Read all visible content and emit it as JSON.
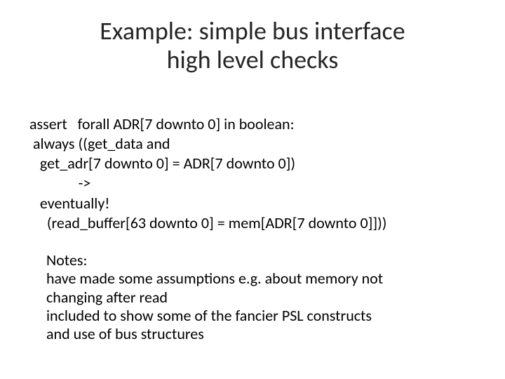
{
  "title_line1": "Example: simple bus interface",
  "title_line2": "high level checks",
  "code": {
    "l1": "assert   forall ADR[7 downto 0] in boolean:",
    "l2": " always ((get_data and",
    "l3": "   get_adr[7 downto 0] = ADR[7 downto 0])",
    "l4": "              ->",
    "l5": "   eventually!",
    "l6": "     (read_buffer[63 downto 0] = mem[ADR[7 downto 0]]))"
  },
  "notes": {
    "heading": "Notes:",
    "n1a": "have made some assumptions e.g. about memory   not",
    "n1b": "changing after read",
    "n2a": " included to show some of the fancier PSL constructs",
    "n2b": "and use of bus structures"
  }
}
